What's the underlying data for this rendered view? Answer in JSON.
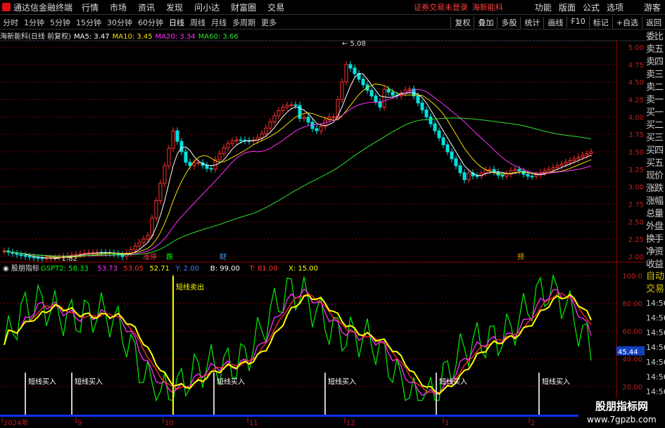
{
  "app": {
    "title": "通达信金融终端",
    "menu": [
      "行情",
      "市场",
      "资讯",
      "发现",
      "问小达",
      "财富圈",
      "交易"
    ],
    "status_login": "证券交易未登录",
    "stock_name_top": "海新能科",
    "right_menu": [
      "功能",
      "版面",
      "公式",
      "选项"
    ],
    "guest": "游客"
  },
  "toolbar": {
    "periods": [
      "分时",
      "1分钟",
      "5分钟",
      "15分钟",
      "30分钟",
      "60分钟",
      "日线",
      "周线",
      "月线",
      "多周期",
      "更多"
    ],
    "active": "日线",
    "buttons": [
      "复权",
      "叠加",
      "多股",
      "统计",
      "画线",
      "F10",
      "标记",
      "+自选",
      "返回"
    ]
  },
  "main_legend": {
    "title": "海新能科(日线 前复权)",
    "ma": [
      {
        "label": "MA5: 3.47",
        "color": "#ffffff"
      },
      {
        "label": "MA10: 3.45",
        "color": "#f0e000"
      },
      {
        "label": "MA20: 3.34",
        "color": "#ff30ff"
      },
      {
        "label": "MA60: 3.66",
        "color": "#30e030"
      }
    ]
  },
  "price_axis": [
    "5.00",
    "4.75",
    "4.50",
    "4.25",
    "4.00",
    "3.75",
    "3.50",
    "3.25",
    "3.00",
    "2.75",
    "2.50",
    "2.25",
    "2.00"
  ],
  "annotations": {
    "high": "5.08",
    "low": "1.82",
    "markers": [
      {
        "text": "涨停",
        "color": "#ff4040"
      },
      {
        "text": "跌",
        "color": "#00ff00"
      },
      {
        "text": "财",
        "color": "#40a0ff"
      },
      {
        "text": "预",
        "color": "#e0a000"
      }
    ]
  },
  "side_panel": [
    "委比",
    "卖五",
    "卖四",
    "卖三",
    "卖二",
    "卖一",
    "买一",
    "买二",
    "买三",
    "买四",
    "买五",
    "现价",
    "涨跌",
    "涨幅",
    "总量",
    "外盘",
    "换手",
    "净资",
    "收益"
  ],
  "indicator": {
    "name": "股朋指标",
    "items": [
      {
        "label": "GSPT2: 58.33",
        "color": "#00ff00"
      },
      {
        "label": "53.73",
        "color": "#ff30ff"
      },
      {
        "label": "53.05",
        "color": "#ff3030"
      },
      {
        "label": "52.71",
        "color": "#ffff00"
      },
      {
        "label": "Y: 2.00",
        "color": "#4080ff"
      },
      {
        "label": "B: 99.00",
        "color": "#ffffff"
      },
      {
        "label": "T: 81.00",
        "color": "#ff3030"
      },
      {
        "label": "X: 15.00",
        "color": "#ffff00"
      }
    ],
    "axis": [
      "100.0",
      "80.00",
      "60.00",
      "40.00",
      "20.00"
    ],
    "current": "45.44",
    "buy_label": "短线买入",
    "sell_label": "短线卖出"
  },
  "side_panel2": {
    "items": [
      "自动",
      "交易"
    ],
    "times": [
      "14:56",
      "14:56",
      "14:56",
      "14:56",
      "14:56",
      "14:56",
      "14:56",
      "14:56",
      "14:56",
      "14:56"
    ]
  },
  "date_axis": [
    "2024年",
    "9",
    "10",
    "11",
    "12",
    "1",
    "2"
  ],
  "watermark": {
    "name": "股朋指标网",
    "url": "www.7gpzb.com"
  }
}
